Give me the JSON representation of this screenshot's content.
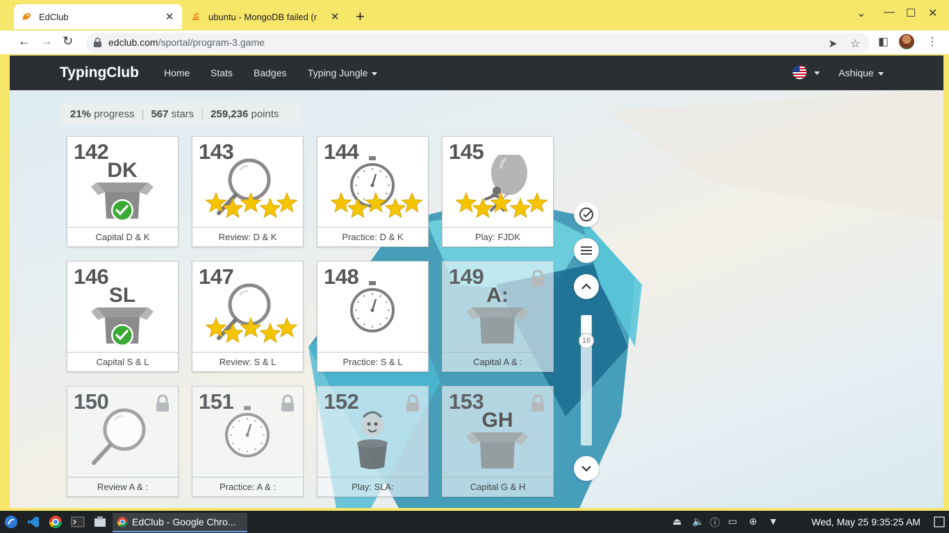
{
  "browser": {
    "tabs": [
      {
        "title": "EdClub",
        "active": true
      },
      {
        "title": "ubuntu - MongoDB failed (r",
        "active": false
      }
    ],
    "url_host": "edclub.com",
    "url_path": "/sportal/program-3.game"
  },
  "site": {
    "brand": "TypingClub",
    "nav": {
      "home": "Home",
      "stats": "Stats",
      "badges": "Badges",
      "jungle": "Typing Jungle",
      "user": "Ashique"
    },
    "progress": {
      "percent": "21%",
      "percent_label": "progress",
      "stars": "567",
      "stars_label": "stars",
      "points": "259,236",
      "points_label": "points"
    },
    "lessons": [
      {
        "num": "142",
        "title": "Capital D & K",
        "type": "capital",
        "letters": "DK",
        "done": true,
        "locked": false
      },
      {
        "num": "143",
        "title": "Review: D & K",
        "type": "review",
        "stars": 5,
        "locked": false
      },
      {
        "num": "144",
        "title": "Practice: D & K",
        "type": "practice",
        "stars": 5,
        "locked": false
      },
      {
        "num": "145",
        "title": "Play: FJDK",
        "type": "play",
        "stars": 5,
        "locked": false
      },
      {
        "num": "146",
        "title": "Capital S & L",
        "type": "capital",
        "letters": "SL",
        "done": true,
        "locked": false
      },
      {
        "num": "147",
        "title": "Review: S & L",
        "type": "review",
        "stars": 5,
        "locked": false
      },
      {
        "num": "148",
        "title": "Practice: S & L",
        "type": "practice",
        "stars": 0,
        "locked": false
      },
      {
        "num": "149",
        "title": "Capital A & :",
        "type": "capital",
        "letters": "A:",
        "done": false,
        "locked": true
      },
      {
        "num": "150",
        "title": "Review A & :",
        "type": "review",
        "stars": 0,
        "locked": true
      },
      {
        "num": "151",
        "title": "Practice: A & :",
        "type": "practice",
        "stars": 0,
        "locked": true
      },
      {
        "num": "152",
        "title": "Play: SLA:",
        "type": "play",
        "stars": 0,
        "locked": true
      },
      {
        "num": "153",
        "title": "Capital G & H",
        "type": "capital",
        "letters": "GH",
        "done": false,
        "locked": true
      }
    ],
    "scroll_position": "16"
  },
  "taskbar": {
    "active_task": "EdClub - Google Chro...",
    "clock": "Wed, May 25  9:35:25 AM"
  },
  "colors": {
    "star": "#f5c400",
    "check": "#3aaa35",
    "nav_bg": "#2b2f33"
  }
}
